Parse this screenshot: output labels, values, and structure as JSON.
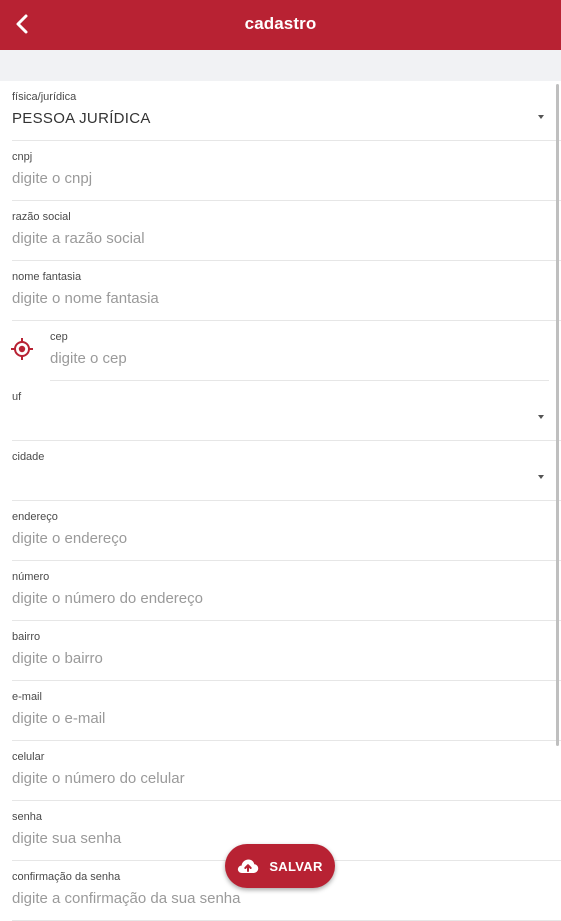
{
  "header": {
    "title": "cadastro",
    "back_icon": "chevron-left-icon"
  },
  "colors": {
    "brand": "#b82233",
    "band": "#f1f2f4"
  },
  "form": {
    "tipo": {
      "label": "física/jurídica",
      "value": "PESSOA JURÍDICA"
    },
    "cnpj": {
      "label": "cnpj",
      "placeholder": "digite o cnpj"
    },
    "razao": {
      "label": "razão social",
      "placeholder": "digite a razão social"
    },
    "fantasia": {
      "label": "nome fantasia",
      "placeholder": "digite o nome fantasia"
    },
    "cep": {
      "label": "cep",
      "placeholder": "digite o cep",
      "icon": "locate-icon"
    },
    "uf": {
      "label": "uf",
      "value": ""
    },
    "cidade": {
      "label": "cidade",
      "value": ""
    },
    "endereco": {
      "label": "endereço",
      "placeholder": "digite o endereço"
    },
    "numero": {
      "label": "número",
      "placeholder": "digite o número do endereço"
    },
    "bairro": {
      "label": "bairro",
      "placeholder": "digite o bairro"
    },
    "email": {
      "label": "e-mail",
      "placeholder": "digite o e-mail"
    },
    "celular": {
      "label": "celular",
      "placeholder": "digite o número do celular"
    },
    "senha": {
      "label": "senha",
      "placeholder": "digite sua senha"
    },
    "confirmacao": {
      "label": "confirmação da senha",
      "placeholder": "digite a confirmação da sua senha"
    }
  },
  "save_button": {
    "label": "SALVAR",
    "icon": "cloud-upload-icon"
  }
}
